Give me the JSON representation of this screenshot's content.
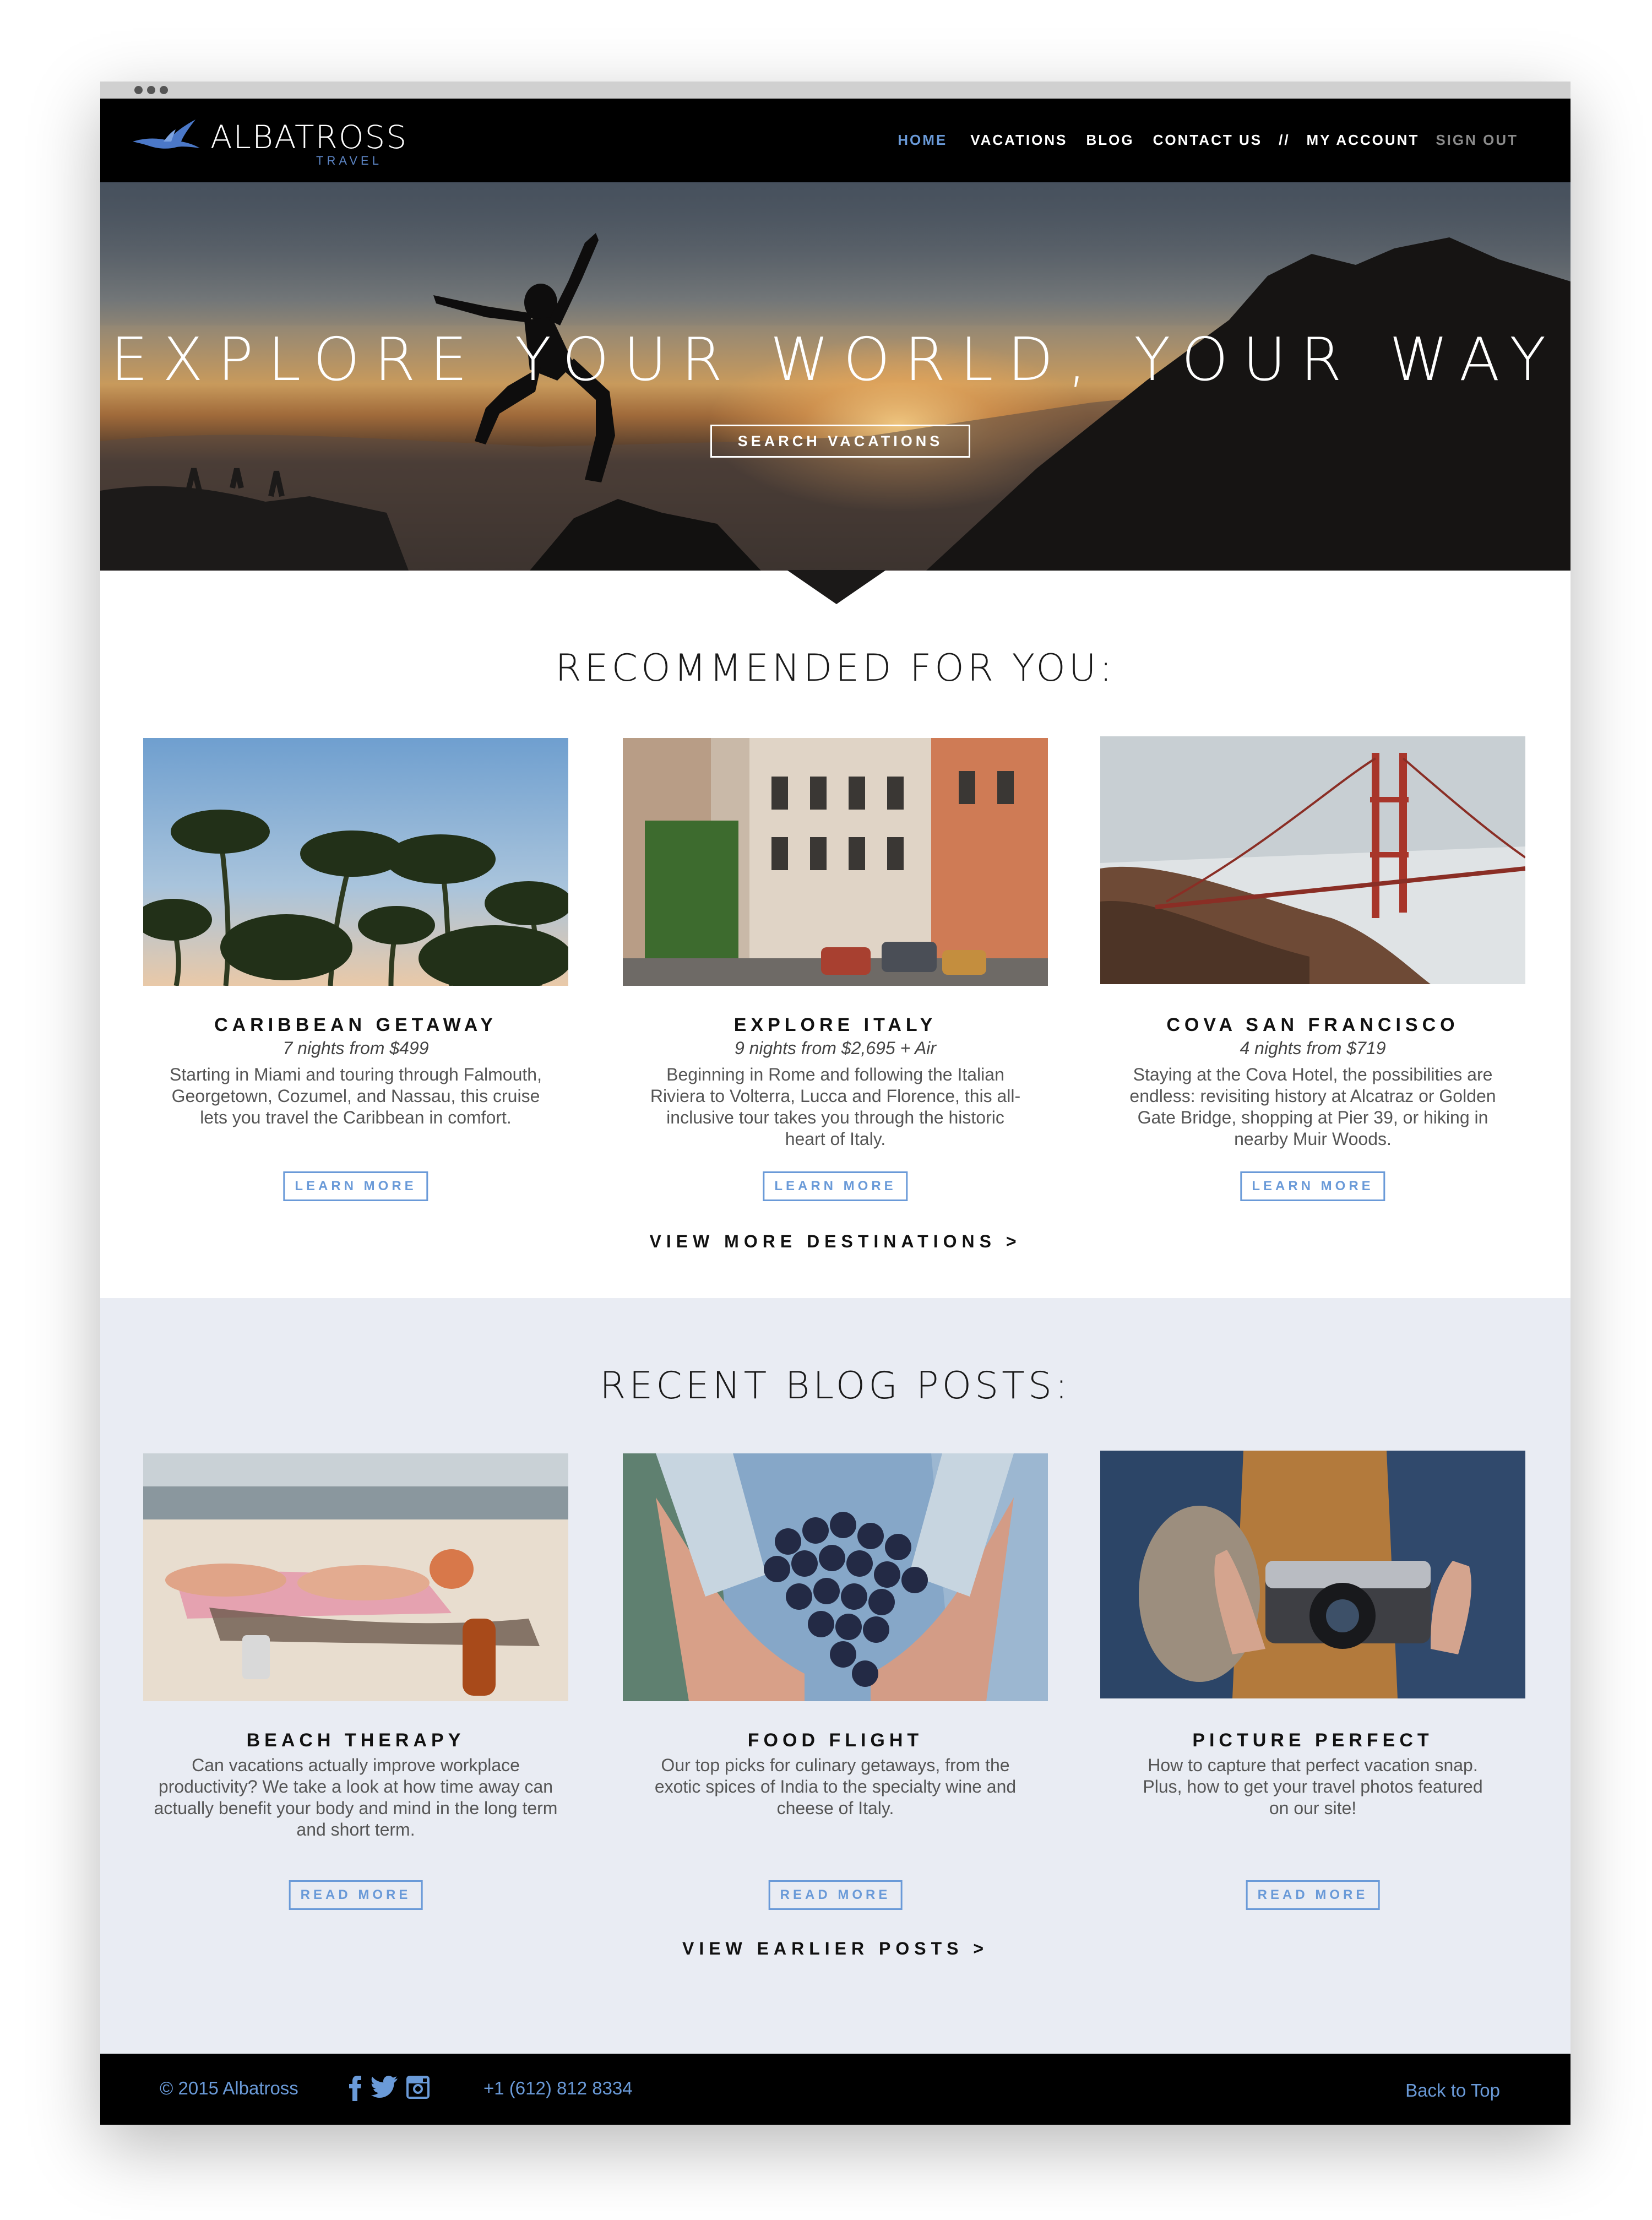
{
  "brand": {
    "name": "ALBATROSS",
    "sub": "TRAVEL"
  },
  "nav": {
    "home": "HOME",
    "vacations": "VACATIONS",
    "blog": "BLOG",
    "contact": "CONTACT US",
    "separator": "//",
    "account": "MY ACCOUNT",
    "signout": "SIGN OUT"
  },
  "hero": {
    "title": "EXPLORE YOUR WORLD, YOUR WAY",
    "button": "SEARCH VACATIONS"
  },
  "recommended": {
    "heading": "RECOMMENDED FOR YOU:",
    "cards": [
      {
        "title": "CARIBBEAN GETAWAY",
        "sub": "7 nights from $499",
        "desc": "Starting in Miami and touring through Falmouth, Georgetown, Cozumel, and Nassau, this cruise lets you travel the Caribbean in comfort.",
        "button": "LEARN MORE"
      },
      {
        "title": "EXPLORE ITALY",
        "sub": "9 nights from $2,695 + Air",
        "desc": "Beginning in Rome and following the Italian Riviera to Volterra, Lucca and Florence, this all-inclusive tour takes you through the historic heart of Italy.",
        "button": "LEARN MORE"
      },
      {
        "title": "COVA SAN FRANCISCO",
        "sub": "4 nights from $719",
        "desc": "Staying at the Cova Hotel, the possibilities are endless: revisiting history at Alcatraz or Golden Gate Bridge, shopping at Pier 39, or hiking in nearby Muir Woods.",
        "button": "LEARN MORE"
      }
    ],
    "view_more": "VIEW MORE DESTINATIONS >"
  },
  "blog": {
    "heading": "RECENT BLOG POSTS:",
    "posts": [
      {
        "title": "BEACH THERAPY",
        "desc": "Can vacations actually improve workplace productivity? We take a look at how time away can actually benefit your body and mind in the long term and short term.",
        "button": "READ MORE"
      },
      {
        "title": "FOOD FLIGHT",
        "desc": "Our top picks for culinary getaways, from the exotic spices of India to the specialty wine and cheese of Italy.",
        "button": "READ MORE"
      },
      {
        "title": "PICTURE PERFECT",
        "desc": "How to capture that perfect vacation snap. Plus, how to get your travel photos featured on our site!",
        "button": "READ MORE"
      }
    ],
    "view_more": "VIEW EARLIER  POSTS >"
  },
  "footer": {
    "copyright": "© 2015 Albatross",
    "social_icons": [
      "facebook-icon",
      "twitter-icon",
      "instagram-icon"
    ],
    "phone": "+1 (612) 812 8334",
    "back_to_top": "Back to Top"
  },
  "colors": {
    "accent": "#6a9ad8",
    "header_bg": "#000000",
    "blog_bg": "#e9ecf3"
  }
}
